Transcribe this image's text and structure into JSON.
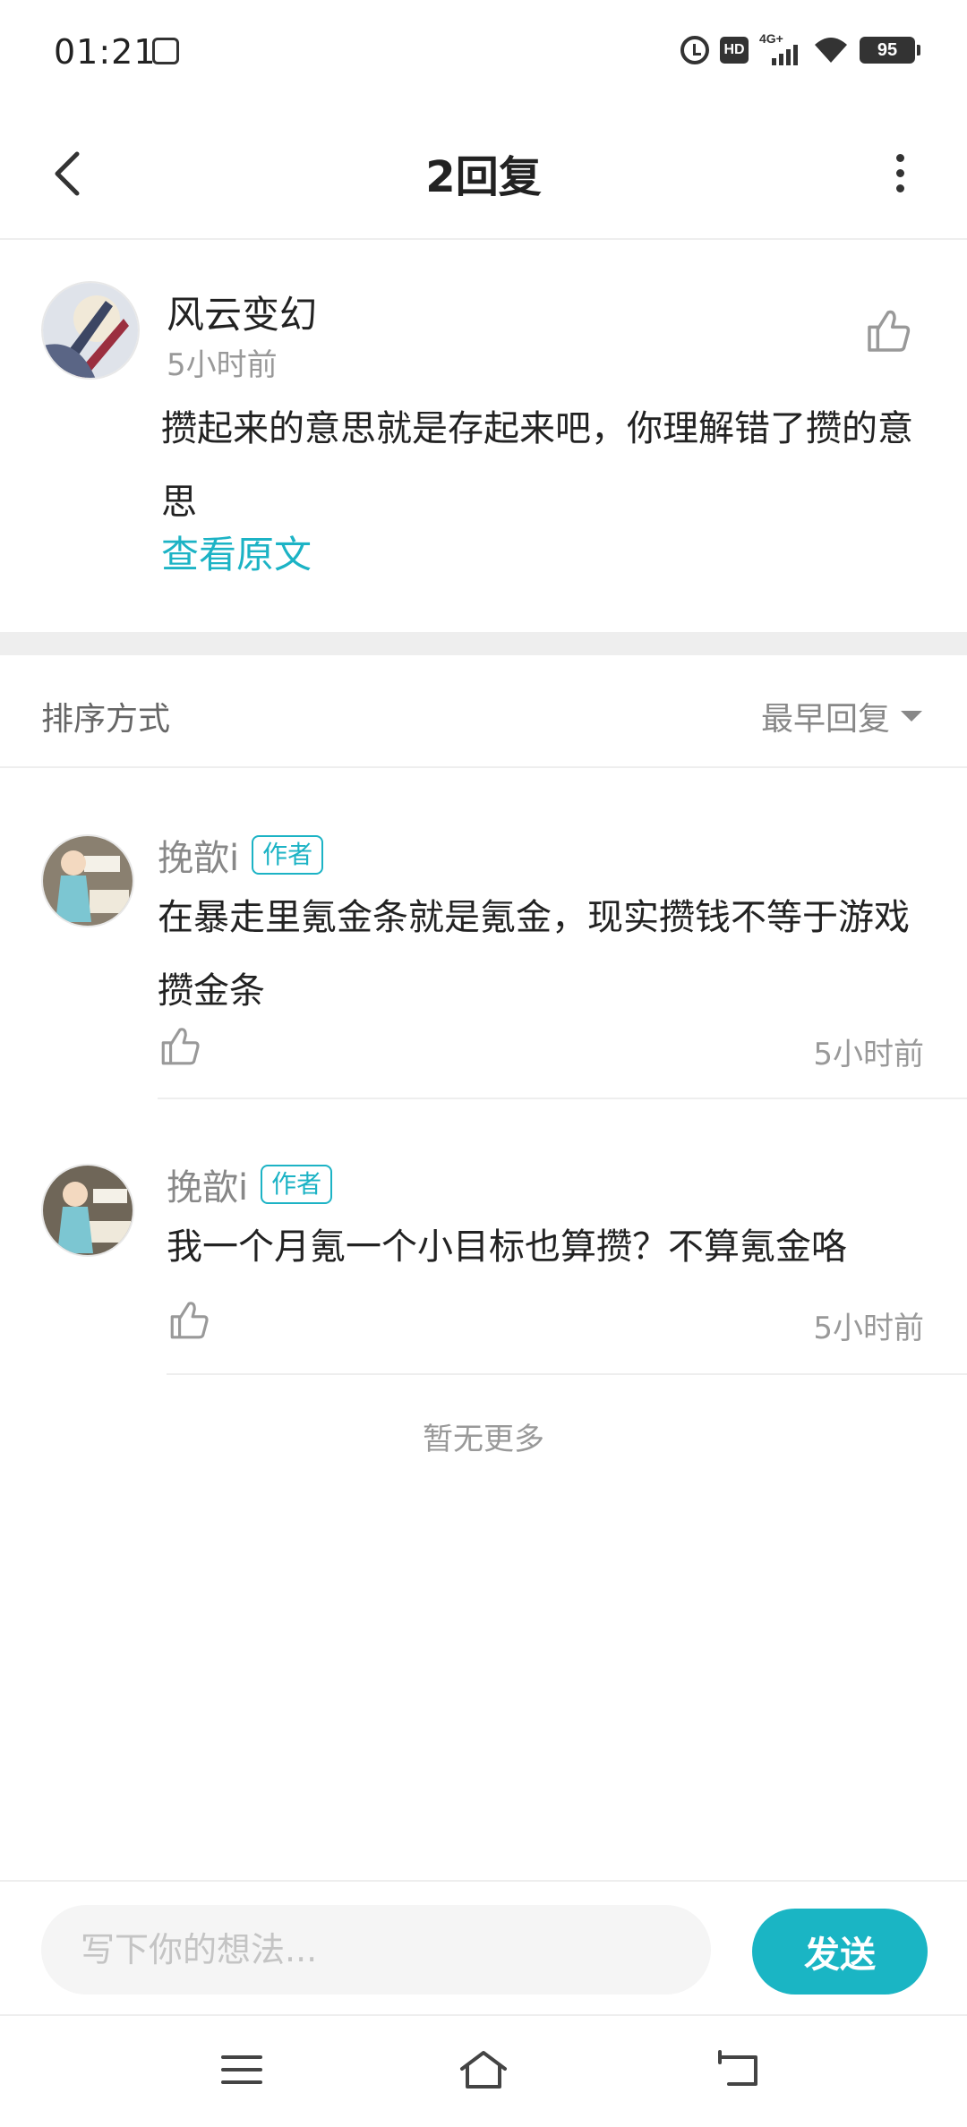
{
  "status_bar": {
    "time": "01:21",
    "signal_label": "4G+",
    "battery": "95",
    "hd_label": "HD"
  },
  "header": {
    "title": "2回复"
  },
  "original_comment": {
    "author": "风云变幻",
    "time": "5小时前",
    "text": "攒起来的意思就是存起来吧，你理解错了攒的意思",
    "view_original_label": "查看原文"
  },
  "sort": {
    "label": "排序方式",
    "selected": "最早回复"
  },
  "replies": [
    {
      "author": "挽歆i",
      "badge": "作者",
      "text": "在暴走里氪金条就是氪金，现实攒钱不等于游戏攒金条",
      "time": "5小时前"
    },
    {
      "author": "挽歆i",
      "badge": "作者",
      "text": "我一个月氪一个小目标也算攒？不算氪金咯",
      "time": "5小时前"
    }
  ],
  "no_more_label": "暂无更多",
  "input": {
    "placeholder": "写下你的想法...",
    "send_label": "发送"
  },
  "colors": {
    "accent": "#1cb3c5",
    "send_button": "#1ab5c4",
    "divider": "#eeeeee"
  },
  "icons": [
    "back-arrow-icon",
    "more-vertical-icon",
    "thumbs-up-icon",
    "dropdown-triangle-icon",
    "menu-icon",
    "home-icon",
    "back-nav-icon"
  ]
}
